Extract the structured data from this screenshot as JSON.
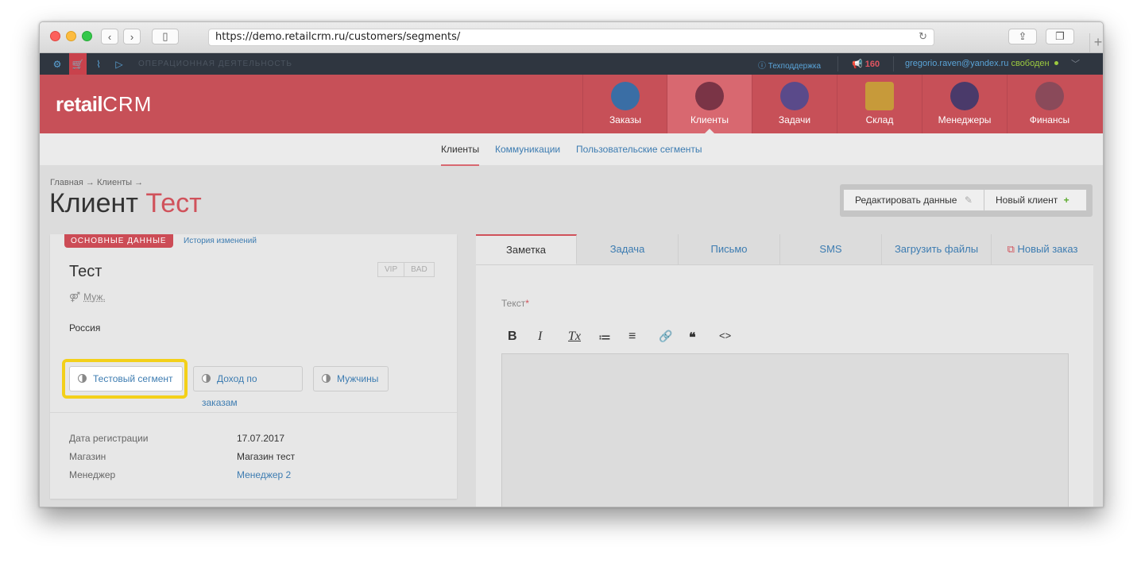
{
  "browser": {
    "url": "https://demo.retailcrm.ru/customers/segments/",
    "reload_icon": "reload-icon",
    "new_tab_label": "+"
  },
  "topbar": {
    "section": "ОПЕРАЦИОННАЯ ДЕЯТЕЛЬНОСТЬ",
    "support": "Техподдержка",
    "notifications": "160",
    "user_email": "gregorio.raven@yandex.ru",
    "user_status": "свободен"
  },
  "logo": {
    "prefix": "retail",
    "suffix": "CRM"
  },
  "nav": [
    {
      "label": "Заказы",
      "color": "#3a6ea5"
    },
    {
      "label": "Клиенты",
      "color": "#7a3446"
    },
    {
      "label": "Задачи",
      "color": "#5a4a8a"
    },
    {
      "label": "Склад",
      "color": "#c79a3a"
    },
    {
      "label": "Менеджеры",
      "color": "#4a3a6a"
    },
    {
      "label": "Финансы",
      "color": "#8a4a5a"
    }
  ],
  "subnav": {
    "items": [
      "Клиенты",
      "Коммуникации",
      "Пользовательские сегменты"
    ]
  },
  "breadcrumb": "Главная → Клиенты →",
  "page_title": {
    "prefix": "Клиент",
    "name": "Тест"
  },
  "actions": {
    "edit": "Редактировать данные",
    "new_client": "Новый клиент"
  },
  "card": {
    "tag": "ОСНОВНЫЕ ДАННЫЕ",
    "history": "История изменений",
    "name": "Тест",
    "badges": [
      "VIP",
      "BAD"
    ],
    "gender": "Муж.",
    "country": "Россия",
    "segments": [
      "Тестовый сегмент",
      "Доход по заказам",
      "Мужчины"
    ],
    "info": [
      {
        "label": "Дата регистрации",
        "value": "17.07.2017"
      },
      {
        "label": "Магазин",
        "value": "Магазин тест"
      },
      {
        "label": "Менеджер",
        "value": "Менеджер 2"
      }
    ]
  },
  "tabs": [
    "Заметка",
    "Задача",
    "Письмо",
    "SMS",
    "Загрузить файлы",
    "Новый заказ"
  ],
  "note": {
    "label": "Текст",
    "required": "*",
    "toolbar": [
      "B",
      "I",
      "Tx",
      "≔",
      "≡",
      "🔗",
      "❝",
      "<>"
    ]
  }
}
